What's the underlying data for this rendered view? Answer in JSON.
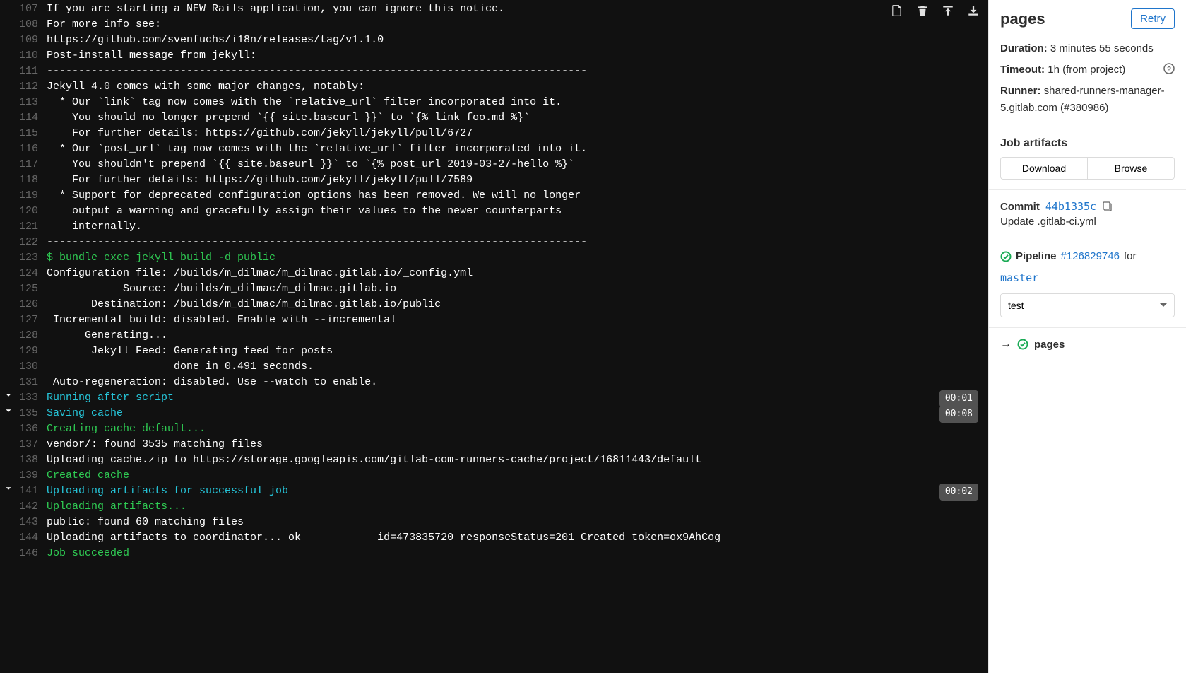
{
  "sidebar": {
    "title": "pages",
    "retry_label": "Retry",
    "duration_label": "Duration:",
    "duration_value": "3 minutes 55 seconds",
    "timeout_label": "Timeout:",
    "timeout_value": "1h (from project)",
    "runner_label": "Runner:",
    "runner_value": "shared-runners-manager-5.gitlab.com (#380986)",
    "artifacts_title": "Job artifacts",
    "download_label": "Download",
    "browse_label": "Browse",
    "commit_label": "Commit",
    "commit_sha": "44b1335c",
    "commit_message": "Update .gitlab-ci.yml",
    "pipeline_label": "Pipeline",
    "pipeline_id": "#126829746",
    "pipeline_for": "for",
    "pipeline_branch": "master",
    "stage_selected": "test",
    "current_job": "pages"
  },
  "log": {
    "lines": [
      {
        "n": 107,
        "t": "If you are starting a NEW Rails application, you can ignore this notice.",
        "c": ""
      },
      {
        "n": 108,
        "t": "For more info see:",
        "c": ""
      },
      {
        "n": 109,
        "t": "https://github.com/svenfuchs/i18n/releases/tag/v1.1.0",
        "c": ""
      },
      {
        "n": 110,
        "t": "Post-install message from jekyll:",
        "c": ""
      },
      {
        "n": 111,
        "t": "-------------------------------------------------------------------------------------",
        "c": ""
      },
      {
        "n": 112,
        "t": "Jekyll 4.0 comes with some major changes, notably:",
        "c": ""
      },
      {
        "n": 113,
        "t": "  * Our `link` tag now comes with the `relative_url` filter incorporated into it.",
        "c": ""
      },
      {
        "n": 114,
        "t": "    You should no longer prepend `{{ site.baseurl }}` to `{% link foo.md %}`",
        "c": ""
      },
      {
        "n": 115,
        "t": "    For further details: https://github.com/jekyll/jekyll/pull/6727",
        "c": ""
      },
      {
        "n": 116,
        "t": "  * Our `post_url` tag now comes with the `relative_url` filter incorporated into it.",
        "c": ""
      },
      {
        "n": 117,
        "t": "    You shouldn't prepend `{{ site.baseurl }}` to `{% post_url 2019-03-27-hello %}`",
        "c": ""
      },
      {
        "n": 118,
        "t": "    For further details: https://github.com/jekyll/jekyll/pull/7589",
        "c": ""
      },
      {
        "n": 119,
        "t": "  * Support for deprecated configuration options has been removed. We will no longer",
        "c": ""
      },
      {
        "n": 120,
        "t": "    output a warning and gracefully assign their values to the newer counterparts",
        "c": ""
      },
      {
        "n": 121,
        "t": "    internally.",
        "c": ""
      },
      {
        "n": 122,
        "t": "-------------------------------------------------------------------------------------",
        "c": ""
      },
      {
        "n": 123,
        "t": "$ bundle exec jekyll build -d public",
        "c": "green"
      },
      {
        "n": 124,
        "t": "Configuration file: /builds/m_dilmac/m_dilmac.gitlab.io/_config.yml",
        "c": ""
      },
      {
        "n": 125,
        "t": "            Source: /builds/m_dilmac/m_dilmac.gitlab.io",
        "c": ""
      },
      {
        "n": 126,
        "t": "       Destination: /builds/m_dilmac/m_dilmac.gitlab.io/public",
        "c": ""
      },
      {
        "n": 127,
        "t": " Incremental build: disabled. Enable with --incremental",
        "c": ""
      },
      {
        "n": 128,
        "t": "      Generating...",
        "c": ""
      },
      {
        "n": 129,
        "t": "       Jekyll Feed: Generating feed for posts",
        "c": ""
      },
      {
        "n": 130,
        "t": "                    done in 0.491 seconds.",
        "c": ""
      },
      {
        "n": 131,
        "t": " Auto-regeneration: disabled. Use --watch to enable.",
        "c": ""
      },
      {
        "n": 133,
        "t": "Running after script",
        "c": "cyan",
        "chev": true,
        "time": "00:01"
      },
      {
        "n": 135,
        "t": "Saving cache",
        "c": "cyan",
        "chev": true,
        "time": "00:08"
      },
      {
        "n": 136,
        "t": "Creating cache default...",
        "c": "green"
      },
      {
        "n": 137,
        "t": "vendor/: found 3535 matching files",
        "c": ""
      },
      {
        "n": 138,
        "t": "Uploading cache.zip to https://storage.googleapis.com/gitlab-com-runners-cache/project/16811443/default",
        "c": ""
      },
      {
        "n": 139,
        "t": "Created cache",
        "c": "green"
      },
      {
        "n": 141,
        "t": "Uploading artifacts for successful job",
        "c": "cyan",
        "chev": true,
        "time": "00:02"
      },
      {
        "n": 142,
        "t": "Uploading artifacts...",
        "c": "green"
      },
      {
        "n": 143,
        "t": "public: found 60 matching files",
        "c": ""
      },
      {
        "n": 144,
        "t": "Uploading artifacts to coordinator... ok            id=473835720 responseStatus=201 Created token=ox9AhCog",
        "c": ""
      },
      {
        "n": 146,
        "t": "Job succeeded",
        "c": "green"
      }
    ]
  }
}
